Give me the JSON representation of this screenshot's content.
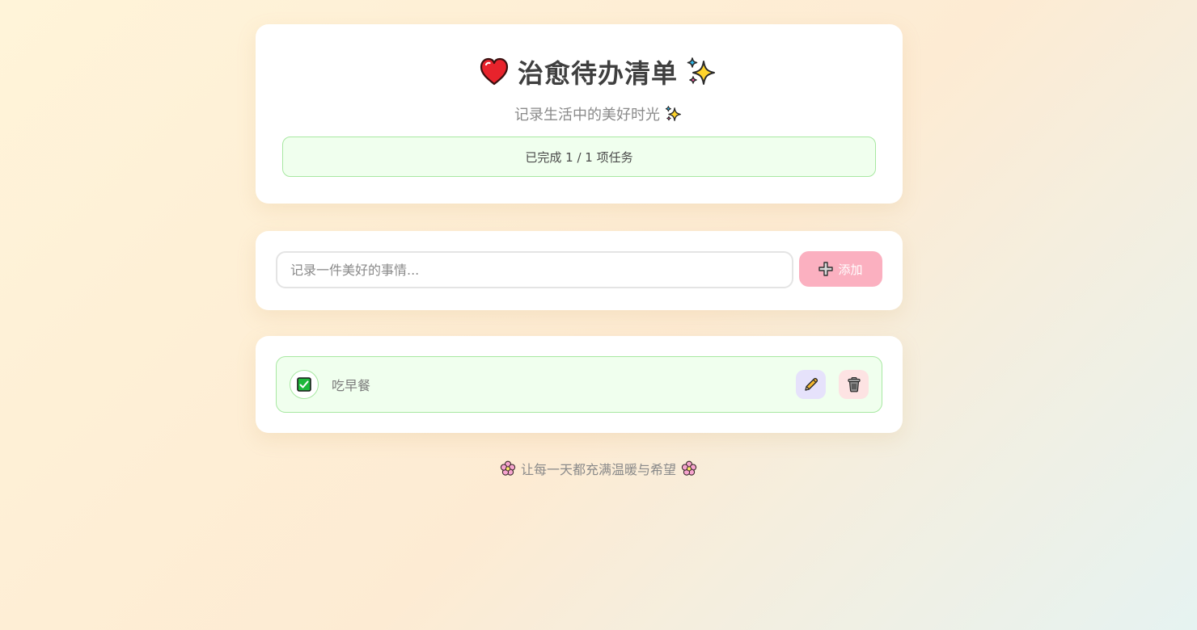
{
  "header": {
    "title": "治愈待办清单",
    "title_icons": [
      "heart-icon",
      "sparkles-icon"
    ],
    "subtitle": "记录生活中的美好时光",
    "subtitle_icon": "sparkles-icon",
    "progress_text": "已完成 1 / 1 项任务"
  },
  "input": {
    "placeholder": "记录一件美好的事情...",
    "value": "",
    "add_label": "添加",
    "add_icon": "plus-icon"
  },
  "tasks": [
    {
      "text": "吃早餐",
      "completed": true
    }
  ],
  "footer": {
    "text": "让每一天都充满温暖与希望",
    "icon": "cherry-blossom-icon"
  },
  "colors": {
    "accent_pink": "#fbb0c0",
    "success_bg": "#f0ffee",
    "success_border": "#a8e8a2",
    "edit_bg": "#e6e2fb",
    "delete_bg": "#fde3e3",
    "checkbox_green": "#1db83a"
  }
}
